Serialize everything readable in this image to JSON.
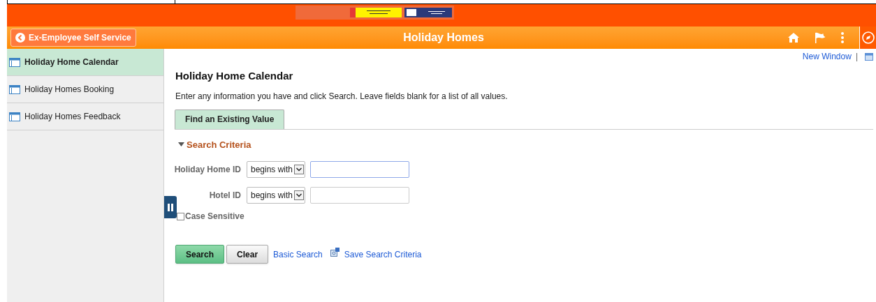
{
  "header": {
    "back_button": "Ex-Employee Self Service",
    "title": "Holiday Homes"
  },
  "sidebar": {
    "items": [
      {
        "label": "Holiday Home Calendar",
        "selected": true
      },
      {
        "label": "Holiday Homes Booking",
        "selected": false
      },
      {
        "label": "Holiday Homes Feedback",
        "selected": false
      }
    ]
  },
  "new_window_link": "New Window",
  "separator": "|",
  "page_title": "Holiday Home Calendar",
  "instructions": "Enter any information you have and click Search. Leave fields blank for a list of all values.",
  "tabs": [
    {
      "label": "Find an Existing Value",
      "selected": true
    }
  ],
  "search_criteria": {
    "heading": "Search Criteria",
    "expanded": true,
    "fields": [
      {
        "label": "Holiday Home ID",
        "operator": "begins with",
        "focused": true
      },
      {
        "label": "Hotel ID",
        "operator": "begins with",
        "focused": false
      }
    ],
    "case_sensitive": {
      "label": "Case Sensitive",
      "checked": false
    }
  },
  "buttons": [
    {
      "label": "Search",
      "kind": "primary"
    },
    {
      "label": "Clear",
      "kind": "secondary"
    }
  ],
  "links": [
    {
      "label": "Basic Search",
      "kind": "plain"
    },
    {
      "label": "Save Search Criteria",
      "kind": "with_icon"
    }
  ]
}
